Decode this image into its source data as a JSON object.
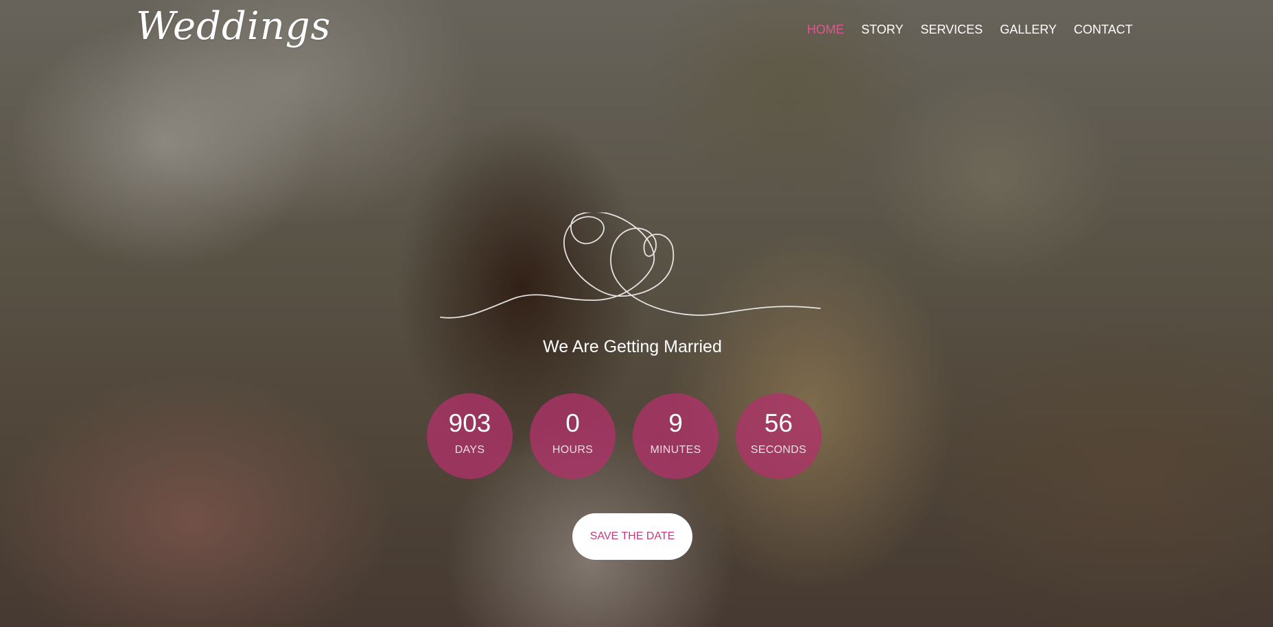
{
  "brand": {
    "logo_text": "Weddings"
  },
  "nav": {
    "items": [
      {
        "label": "HOME",
        "active": true
      },
      {
        "label": "STORY",
        "active": false
      },
      {
        "label": "SERVICES",
        "active": false
      },
      {
        "label": "GALLERY",
        "active": false
      },
      {
        "label": "CONTACT",
        "active": false
      }
    ]
  },
  "hero": {
    "headline": "We Are Getting Married",
    "countdown": [
      {
        "value": "903",
        "unit": "DAYS"
      },
      {
        "value": "0",
        "unit": "HOURS"
      },
      {
        "value": "9",
        "unit": "MINUTES"
      },
      {
        "value": "56",
        "unit": "SECONDS"
      }
    ],
    "cta_label": "SAVE THE DATE"
  },
  "colors": {
    "accent": "#e0568f",
    "circle": "#af3269",
    "button_text": "#c23a7d"
  },
  "icons": {
    "ornament": "two-hearts-line-icon"
  }
}
